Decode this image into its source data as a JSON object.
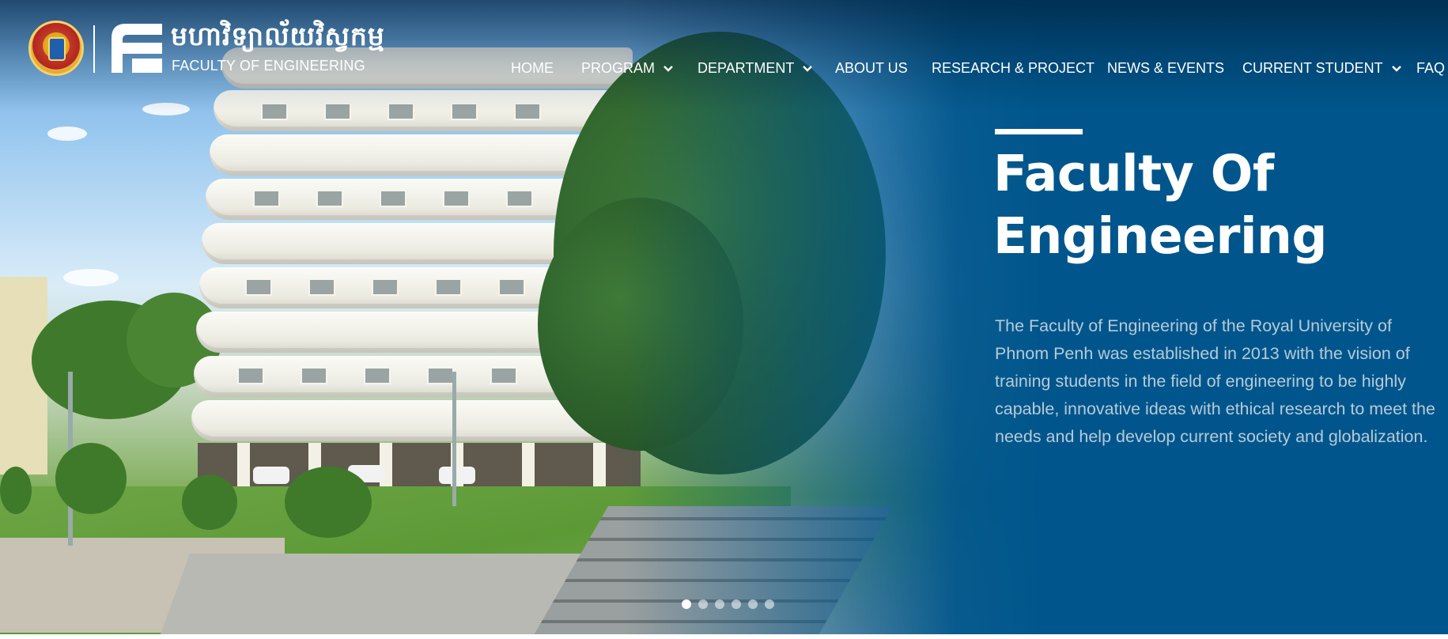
{
  "header": {
    "khmer_name": "មហាវិទ្យាល័យវិស្វកម្ម",
    "faculty_name": "FACULTY OF ENGINEERING"
  },
  "nav": {
    "items": [
      {
        "label": "HOME",
        "has_dropdown": false
      },
      {
        "label": "PROGRAM",
        "has_dropdown": true
      },
      {
        "label": "DEPARTMENT",
        "has_dropdown": true
      },
      {
        "label": "ABOUT US",
        "has_dropdown": false
      },
      {
        "label": "RESEARCH & PROJECT",
        "has_dropdown": false
      },
      {
        "label": "NEWS & EVENTS",
        "has_dropdown": false
      },
      {
        "label": "CURRENT STUDENT",
        "has_dropdown": true
      },
      {
        "label": "FAQ",
        "has_dropdown": false
      }
    ]
  },
  "hero": {
    "title_line1": "Faculty Of",
    "title_line2": "Engineering",
    "description": "The Faculty of Engineering of the Royal University of Phnom Penh was established in 2013 with the vision of training students in the field of engineering to be highly capable, innovative ideas with ethical research to meet the needs and help develop current society and globalization.",
    "slides_total": 6,
    "active_slide": 1
  },
  "colors": {
    "brand_blue": "#00568c",
    "text_white": "#ffffff",
    "desc_text": "#b7cad8"
  },
  "icons": {
    "seal": "rupp-seal-icon",
    "logo": "fe-logo-icon",
    "dropdown": "chevron-down-icon"
  }
}
